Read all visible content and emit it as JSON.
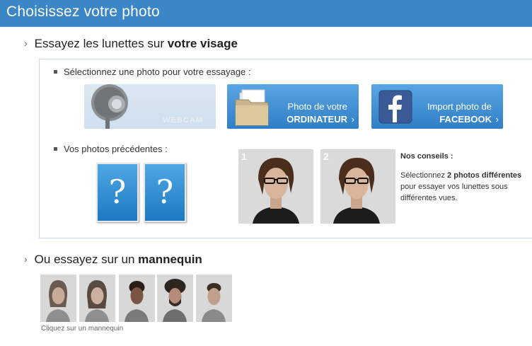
{
  "header": {
    "title": "Choisissez votre photo"
  },
  "section_face": {
    "text": "Essayez les lunettes sur ",
    "bold": "votre visage"
  },
  "select_prompt": "Sélectionnez une photo pour votre essayage :",
  "buttons": {
    "webcam": {
      "label": "WEBCAM"
    },
    "computer": {
      "line1": "Photo de votre",
      "line2": "ORDINATEUR",
      "arrow": "›"
    },
    "facebook": {
      "line1": "Import photo de",
      "line2": "FACEBOOK",
      "arrow": "›"
    }
  },
  "previous": {
    "label": "Vos photos précédentes :",
    "placeholders": [
      "?",
      "?"
    ]
  },
  "samples": {
    "numbers": [
      "1",
      "2"
    ]
  },
  "advice": {
    "title": "Nos conseils :",
    "pre": "Sélectionnez ",
    "bold": "2 photos différentes",
    "post": " pour essayer vos lunettes sous différentes vues."
  },
  "section_model": {
    "text": "Ou essayez sur un ",
    "bold": "mannequin",
    "chevron": "›"
  },
  "models_caption": "Cliquez sur un mannequin",
  "colors": {
    "header": "#3b86c6",
    "button_blue": "#2f7fc6",
    "webcam_button": "#cfdfee"
  },
  "icons": [
    "webcam-icon",
    "folder-icon",
    "facebook-icon"
  ]
}
